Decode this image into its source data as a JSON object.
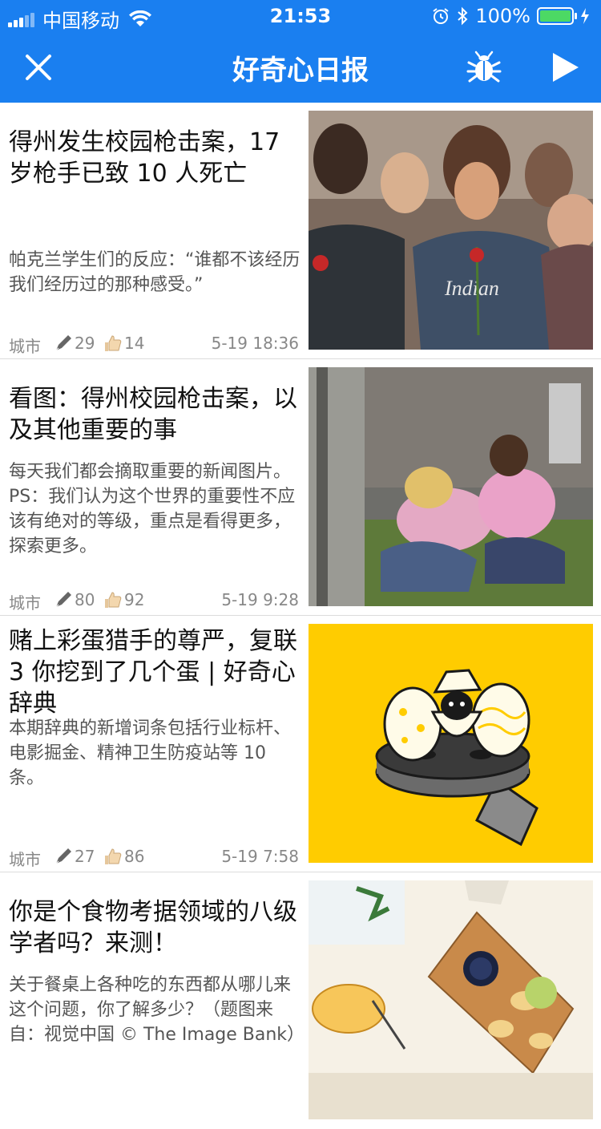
{
  "status": {
    "carrier": "中国移动",
    "time": "21:53",
    "battery": "100%"
  },
  "nav": {
    "title": "好奇心日报",
    "icons": [
      "close-icon",
      "bug-icon",
      "play-icon"
    ],
    "color": "#1a7ff0"
  },
  "articles": [
    {
      "headline": "得州发生校园枪击案，17 岁枪手已致 10 人死亡",
      "summary": "帕克兰学生们的反应：“谁都不该经历我们经历过的那种感受。”",
      "category": "城市",
      "comments": "29",
      "likes": "14",
      "date": "5-19 18:36"
    },
    {
      "headline": "看图：得州校园枪击案，以及其他重要的事",
      "summary": "每天我们都会摘取重要的新闻图片。PS：我们认为这个世界的重要性不应该有绝对的等级，重点是看得更多，探索更多。",
      "category": "城市",
      "comments": "80",
      "likes": "92",
      "date": "5-19 9:28"
    },
    {
      "headline": "赌上彩蛋猎手的尊严，复联 3 你挖到了几个蛋 | 好奇心辞典",
      "summary": "本期辞典的新增词条包括行业标杆、电影掘金、精神卫生防疫站等 10 条。",
      "category": "城市",
      "comments": "27",
      "likes": "86",
      "date": "5-19 7:58"
    },
    {
      "headline": "你是个食物考据领域的八级学者吗？来测！",
      "summary": "关于餐桌上各种吃的东西都从哪儿来这个问题，你了解多少？（题图来自：视觉中国 © The Image Bank）",
      "category": "",
      "comments": "",
      "likes": "",
      "date": ""
    }
  ]
}
